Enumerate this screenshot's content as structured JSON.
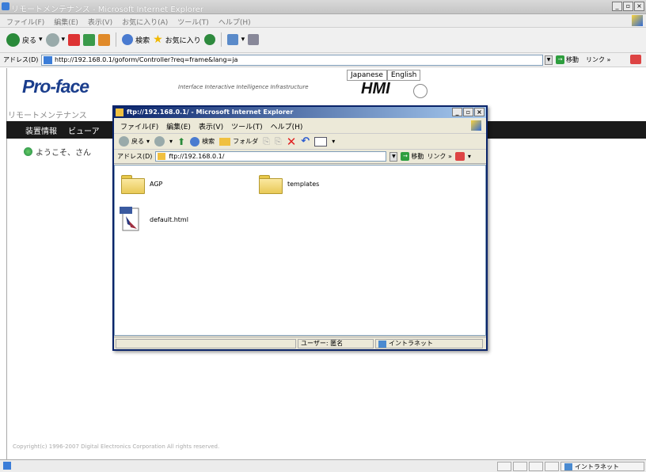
{
  "outer": {
    "window_title": "リモートメンテナンス - Microsoft Internet Explorer",
    "menu": [
      "ファイル(F)",
      "編集(E)",
      "表示(V)",
      "お気に入り(A)",
      "ツール(T)",
      "ヘルプ(H)"
    ],
    "toolbar": {
      "back": "戻る",
      "search": "検索",
      "favorites": "お気に入り"
    },
    "address_label": "アドレス(D)",
    "address_value": "http://192.168.0.1/goform/Controller?req=frame&lang=ja",
    "go_label": "移動",
    "links_label": "リンク »"
  },
  "page": {
    "lang_japanese": "Japanese",
    "lang_english": "English",
    "logo": "Pro-face",
    "tagline": "Interface Interactive Intelligence Infrastructure",
    "hmi": "HMI",
    "remote_title": "リモートメンテナンス",
    "nav": [
      "装置情報",
      "ビューア"
    ],
    "welcome": "ようこそ、さん",
    "copyright": "Copyright(c) 1996-2007 Digital Electronics Corporation All rights reserved."
  },
  "outer_status": {
    "zone": "イントラネット"
  },
  "ftp": {
    "title": "ftp://192.168.0.1/ - Microsoft Internet Explorer",
    "menu": [
      "ファイル(F)",
      "編集(E)",
      "表示(V)",
      "ツール(T)",
      "ヘルプ(H)"
    ],
    "toolbar": {
      "back": "戻る",
      "search": "検索",
      "folders": "フォルダ"
    },
    "address_label": "アドレス(D)",
    "address_value": "ftp://192.168.0.1/",
    "go_label": "移動",
    "links_label": "リンク »",
    "items": [
      {
        "name": "AGP",
        "type": "folder"
      },
      {
        "name": "templates",
        "type": "folder"
      },
      {
        "name": "default.html",
        "type": "html-file"
      }
    ],
    "status_user": "ユーザー: 匿名",
    "status_zone": "イントラネット"
  }
}
